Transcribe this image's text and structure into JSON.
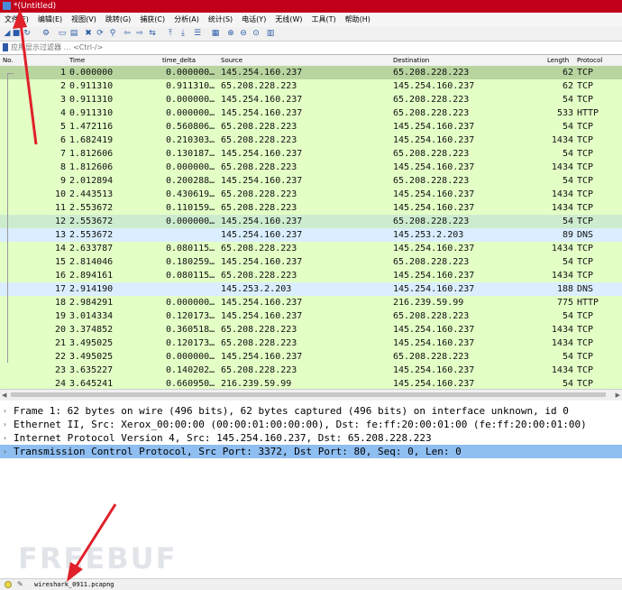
{
  "window": {
    "title": "*(Untitled)"
  },
  "menu": [
    "文件(F)",
    "编辑(E)",
    "视图(V)",
    "跳转(G)",
    "捕获(C)",
    "分析(A)",
    "统计(S)",
    "电话(Y)",
    "无线(W)",
    "工具(T)",
    "帮助(H)"
  ],
  "toolbar_icons": [
    "shark-fin-start-icon",
    "stop-icon",
    "restart-icon",
    "options-gear-icon",
    "open-file-icon",
    "save-icon",
    "close-file-icon",
    "reload-icon",
    "search-icon",
    "back-arrow-icon",
    "forward-arrow-icon",
    "go-to-packet-icon",
    "first-packet-icon",
    "last-packet-icon",
    "autoscroll-icon",
    "colorize-icon",
    "zoom-in-icon",
    "zoom-out-icon",
    "zoom-normal-icon",
    "resize-columns-icon"
  ],
  "filter": {
    "placeholder": "应用显示过滤器 … <Ctrl-/>"
  },
  "columns": {
    "no": "No.",
    "time": "Time",
    "delta": "time_delta",
    "src": "Source",
    "dst": "Destination",
    "len": "Length",
    "proto": "Protocol"
  },
  "packets": [
    {
      "no": "1",
      "time": "0.000000",
      "delta": "0.000000…",
      "src": "145.254.160.237",
      "dst": "65.208.228.223",
      "len": "62",
      "proto": "TCP",
      "color": "#b8d5a0"
    },
    {
      "no": "2",
      "time": "0.911310",
      "delta": "0.911310…",
      "src": "65.208.228.223",
      "dst": "145.254.160.237",
      "len": "62",
      "proto": "TCP",
      "color": "#e3ffc6"
    },
    {
      "no": "3",
      "time": "0.911310",
      "delta": "0.000000…",
      "src": "145.254.160.237",
      "dst": "65.208.228.223",
      "len": "54",
      "proto": "TCP",
      "color": "#e3ffc6"
    },
    {
      "no": "4",
      "time": "0.911310",
      "delta": "0.000000…",
      "src": "145.254.160.237",
      "dst": "65.208.228.223",
      "len": "533",
      "proto": "HTTP",
      "color": "#e3ffc6"
    },
    {
      "no": "5",
      "time": "1.472116",
      "delta": "0.560806…",
      "src": "65.208.228.223",
      "dst": "145.254.160.237",
      "len": "54",
      "proto": "TCP",
      "color": "#e3ffc6"
    },
    {
      "no": "6",
      "time": "1.682419",
      "delta": "0.210303…",
      "src": "65.208.228.223",
      "dst": "145.254.160.237",
      "len": "1434",
      "proto": "TCP",
      "color": "#e3ffc6"
    },
    {
      "no": "7",
      "time": "1.812606",
      "delta": "0.130187…",
      "src": "145.254.160.237",
      "dst": "65.208.228.223",
      "len": "54",
      "proto": "TCP",
      "color": "#e3ffc6"
    },
    {
      "no": "8",
      "time": "1.812606",
      "delta": "0.000000…",
      "src": "65.208.228.223",
      "dst": "145.254.160.237",
      "len": "1434",
      "proto": "TCP",
      "color": "#e3ffc6"
    },
    {
      "no": "9",
      "time": "2.012894",
      "delta": "0.200288…",
      "src": "145.254.160.237",
      "dst": "65.208.228.223",
      "len": "54",
      "proto": "TCP",
      "color": "#e3ffc6"
    },
    {
      "no": "10",
      "time": "2.443513",
      "delta": "0.430619…",
      "src": "65.208.228.223",
      "dst": "145.254.160.237",
      "len": "1434",
      "proto": "TCP",
      "color": "#e3ffc6"
    },
    {
      "no": "11",
      "time": "2.553672",
      "delta": "0.110159…",
      "src": "65.208.228.223",
      "dst": "145.254.160.237",
      "len": "1434",
      "proto": "TCP",
      "color": "#e3ffc6"
    },
    {
      "no": "12",
      "time": "2.553672",
      "delta": "0.000000…",
      "src": "145.254.160.237",
      "dst": "65.208.228.223",
      "len": "54",
      "proto": "TCP",
      "color": "#cdeccf"
    },
    {
      "no": "13",
      "time": "2.553672",
      "delta": "",
      "src": "145.254.160.237",
      "dst": "145.253.2.203",
      "len": "89",
      "proto": "DNS",
      "color": "#daeeff"
    },
    {
      "no": "14",
      "time": "2.633787",
      "delta": "0.080115…",
      "src": "65.208.228.223",
      "dst": "145.254.160.237",
      "len": "1434",
      "proto": "TCP",
      "color": "#e3ffc6"
    },
    {
      "no": "15",
      "time": "2.814046",
      "delta": "0.180259…",
      "src": "145.254.160.237",
      "dst": "65.208.228.223",
      "len": "54",
      "proto": "TCP",
      "color": "#e3ffc6"
    },
    {
      "no": "16",
      "time": "2.894161",
      "delta": "0.080115…",
      "src": "65.208.228.223",
      "dst": "145.254.160.237",
      "len": "1434",
      "proto": "TCP",
      "color": "#e3ffc6"
    },
    {
      "no": "17",
      "time": "2.914190",
      "delta": "",
      "src": "145.253.2.203",
      "dst": "145.254.160.237",
      "len": "188",
      "proto": "DNS",
      "color": "#daeeff"
    },
    {
      "no": "18",
      "time": "2.984291",
      "delta": "0.000000…",
      "src": "145.254.160.237",
      "dst": "216.239.59.99",
      "len": "775",
      "proto": "HTTP",
      "color": "#e3ffc6"
    },
    {
      "no": "19",
      "time": "3.014334",
      "delta": "0.120173…",
      "src": "145.254.160.237",
      "dst": "65.208.228.223",
      "len": "54",
      "proto": "TCP",
      "color": "#e3ffc6"
    },
    {
      "no": "20",
      "time": "3.374852",
      "delta": "0.360518…",
      "src": "65.208.228.223",
      "dst": "145.254.160.237",
      "len": "1434",
      "proto": "TCP",
      "color": "#e3ffc6"
    },
    {
      "no": "21",
      "time": "3.495025",
      "delta": "0.120173…",
      "src": "65.208.228.223",
      "dst": "145.254.160.237",
      "len": "1434",
      "proto": "TCP",
      "color": "#e3ffc6"
    },
    {
      "no": "22",
      "time": "3.495025",
      "delta": "0.000000…",
      "src": "145.254.160.237",
      "dst": "65.208.228.223",
      "len": "54",
      "proto": "TCP",
      "color": "#e3ffc6"
    },
    {
      "no": "23",
      "time": "3.635227",
      "delta": "0.140202…",
      "src": "65.208.228.223",
      "dst": "145.254.160.237",
      "len": "1434",
      "proto": "TCP",
      "color": "#e3ffc6"
    },
    {
      "no": "24",
      "time": "3.645241",
      "delta": "0.660950…",
      "src": "216.239.59.99",
      "dst": "145.254.160.237",
      "len": "54",
      "proto": "TCP",
      "color": "#e3ffc6"
    }
  ],
  "details": [
    {
      "text": "Frame 1: 62 bytes on wire (496 bits), 62 bytes captured (496 bits) on interface unknown, id 0",
      "selected": false
    },
    {
      "text": "Ethernet II, Src: Xerox_00:00:00 (00:00:01:00:00:00), Dst: fe:ff:20:00:01:00 (fe:ff:20:00:01:00)",
      "selected": false
    },
    {
      "text": "Internet Protocol Version 4, Src: 145.254.160.237, Dst: 65.208.228.223",
      "selected": false
    },
    {
      "text": "Transmission Control Protocol, Src Port: 3372, Dst Port: 80, Seq: 0, Len: 0",
      "selected": true
    }
  ],
  "status": {
    "file": "wireshark_0911.pcapng"
  },
  "watermark": "FREEBUF",
  "colors": {
    "titlebar": "#c1001a",
    "selected_detail": "#8fbef0",
    "arrow": "#e0202a"
  }
}
